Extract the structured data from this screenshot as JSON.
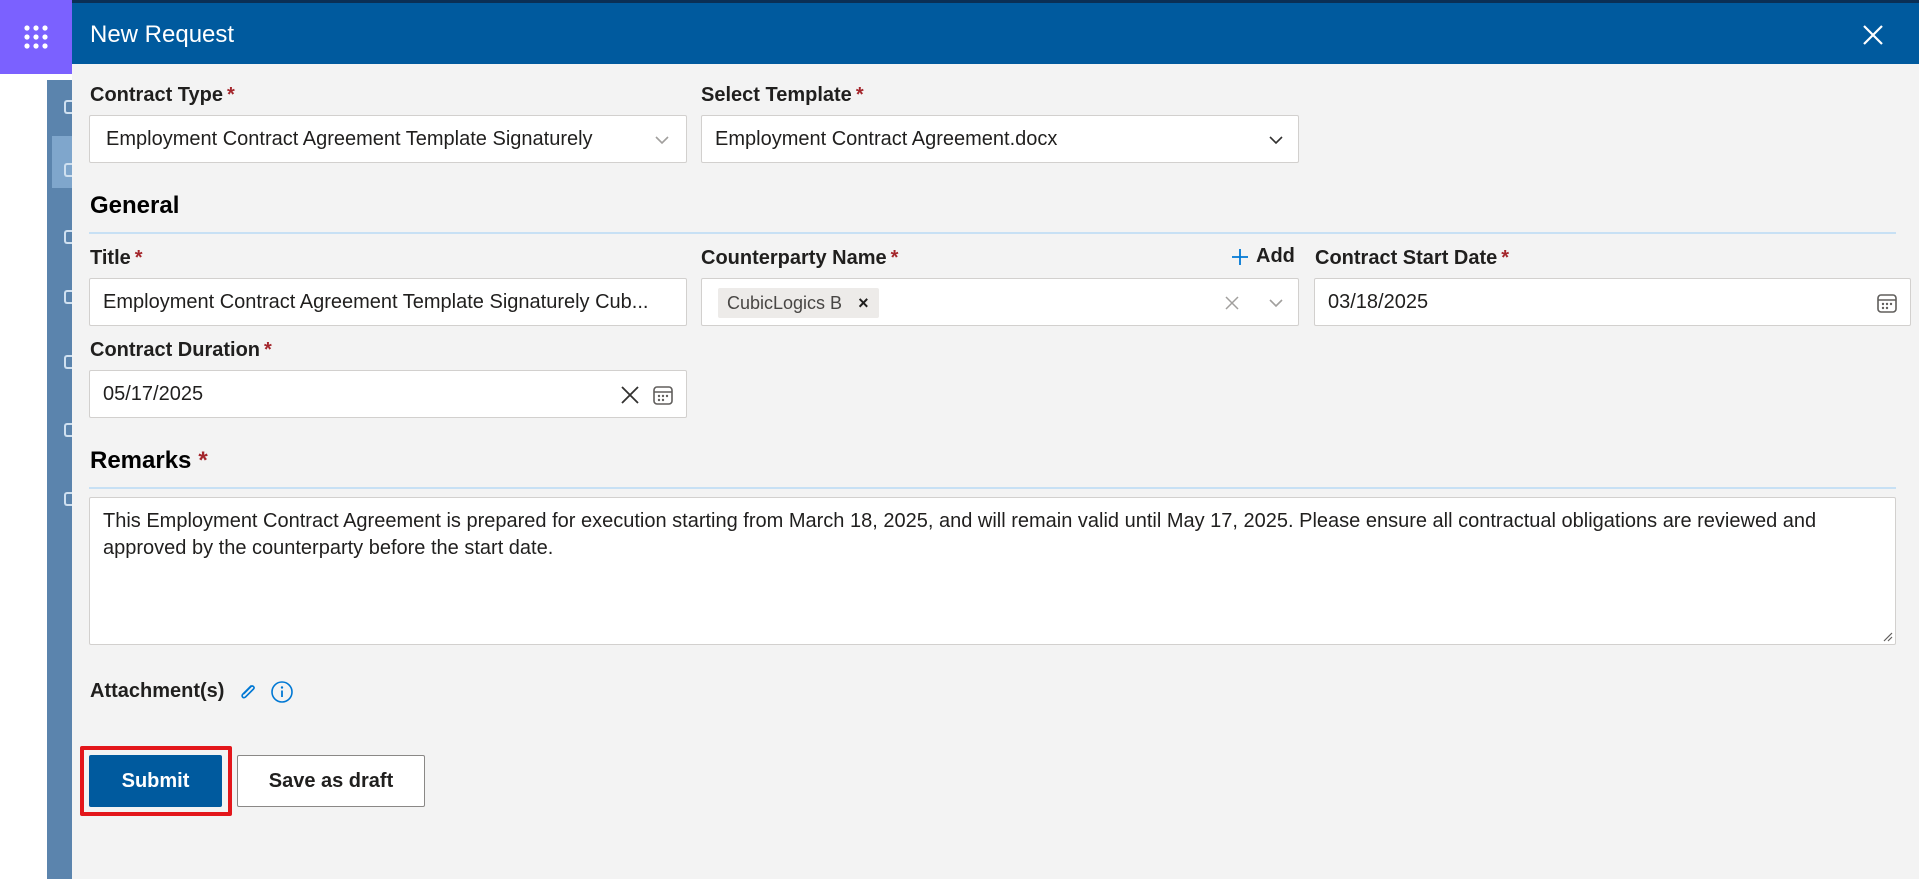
{
  "app": {
    "waffle_icon": "waffle-icon"
  },
  "panel": {
    "title": "New Request",
    "close_icon": "close-icon"
  },
  "contract_type": {
    "label": "Contract Type",
    "required": "*",
    "value": "Employment Contract Agreement Template Signaturely"
  },
  "select_template": {
    "label": "Select Template",
    "required": "*",
    "value": "Employment Contract Agreement.docx"
  },
  "general": {
    "heading": "General"
  },
  "title_field": {
    "label": "Title",
    "required": "*",
    "value": "Employment Contract Agreement Template Signaturely Cub..."
  },
  "counterparty": {
    "label": "Counterparty Name",
    "required": "*",
    "add_label": "Add",
    "chip": "CubicLogics B",
    "chip_remove": "×"
  },
  "start_date": {
    "label": "Contract Start Date",
    "required": "*",
    "value": "03/18/2025"
  },
  "duration": {
    "label": "Contract Duration",
    "required": "*",
    "value": "05/17/2025"
  },
  "remarks": {
    "heading": "Remarks",
    "required": "*",
    "value": "This Employment Contract Agreement is prepared for execution starting from March 18, 2025, and will remain valid until May 17, 2025. Please ensure all contractual obligations are reviewed and approved by the counterparty before the start date."
  },
  "attachments": {
    "label": "Attachment(s)",
    "icons": [
      "paperclip-icon",
      "info-icon"
    ]
  },
  "actions": {
    "submit": "Submit",
    "save_draft": "Save as draft"
  },
  "colors": {
    "header": "#005a9e",
    "accent": "#005a9e",
    "required": "#a4262c",
    "highlight": "#e3161b",
    "waffle": "#7b61ff"
  }
}
